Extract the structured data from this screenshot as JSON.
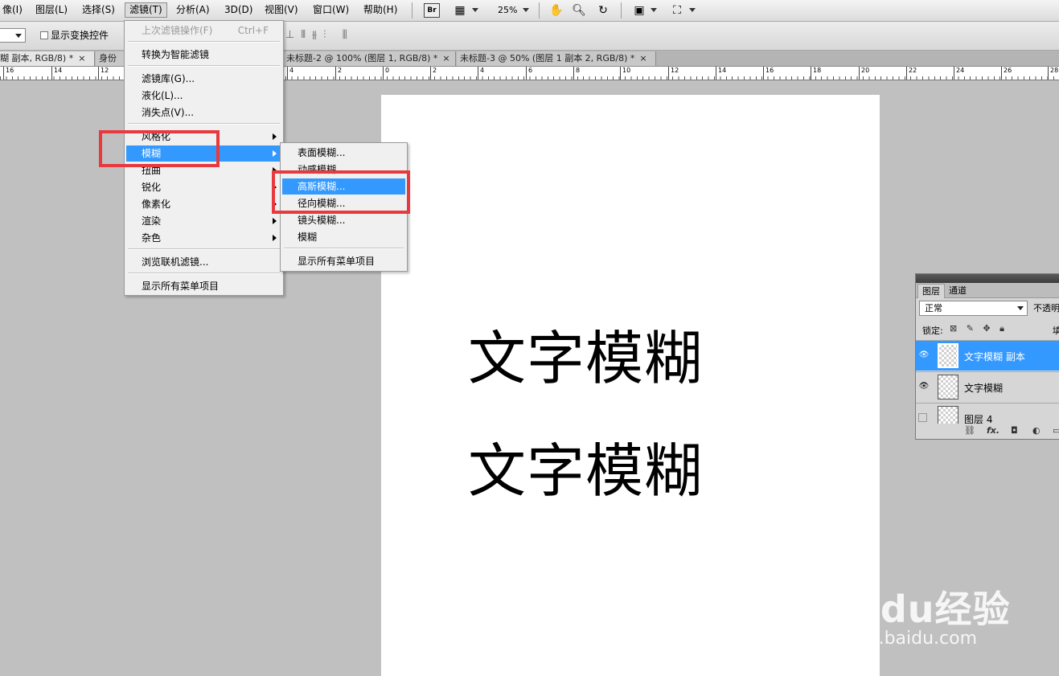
{
  "menubar": {
    "items": [
      "像(I)",
      "图层(L)",
      "选择(S)",
      "滤镜(T)",
      "分析(A)",
      "3D(D)",
      "视图(V)",
      "窗口(W)",
      "帮助(H)"
    ],
    "bridge_badge": "Br",
    "zoom": "25%"
  },
  "options": {
    "show_transform_controls": "显示变换控件"
  },
  "tabs": [
    {
      "label": "糊 副本, RGB/8) *",
      "close": "×"
    },
    {
      "label": "身份",
      "close": ""
    },
    {
      "label": "未标题-2 @ 100% (图层 1, RGB/8) *",
      "close": "×"
    },
    {
      "label": "未标题-3 @ 50% (图层 1 副本 2, RGB/8) *",
      "close": "×"
    }
  ],
  "ruler": {
    "labels": [
      "16",
      "14",
      "12",
      "4",
      "2",
      "0",
      "2",
      "4",
      "6",
      "8",
      "10",
      "12",
      "14",
      "16",
      "18",
      "20",
      "22",
      "24",
      "26",
      "28"
    ]
  },
  "document": {
    "lines": [
      "文字模糊",
      "文字模糊"
    ]
  },
  "filter_menu": {
    "last_filter": "上次滤镜操作(F)",
    "last_filter_shortcut": "Ctrl+F",
    "smart_filter": "转换为智能滤镜",
    "gallery": "滤镜库(G)...",
    "liquify": "液化(L)...",
    "vanishing_point": "消失点(V)...",
    "stylize": "风格化",
    "blur": "模糊",
    "distort": "扭曲",
    "sharpen": "锐化",
    "pixelate": "像素化",
    "render": "渲染",
    "noise": "杂色",
    "browse_online": "浏览联机滤镜...",
    "show_all": "显示所有菜单项目"
  },
  "blur_menu": {
    "surface": "表面模糊...",
    "motion": "动感模糊...",
    "gaussian": "高斯模糊...",
    "radial": "径向模糊...",
    "lens": "镜头模糊...",
    "blur": "模糊",
    "show_all": "显示所有菜单项目"
  },
  "layers_panel": {
    "tab_layers": "图层",
    "tab_channels": "通道",
    "blend_mode": "正常",
    "opacity_label": "不透明",
    "lock_label": "锁定:",
    "fill_label": "填",
    "layers": [
      {
        "name": "文字模糊 副本",
        "selected": true,
        "visible": true
      },
      {
        "name": "文字模糊",
        "selected": false,
        "visible": true
      },
      {
        "name": "图层 4",
        "selected": false,
        "visible": false
      }
    ],
    "footer_fx": "fx."
  },
  "watermark": {
    "main": "Baidu经验",
    "sub": "jingyan.baidu.com"
  },
  "colors": {
    "highlight": "#3399ff",
    "annotation_red": "#e8393e"
  }
}
